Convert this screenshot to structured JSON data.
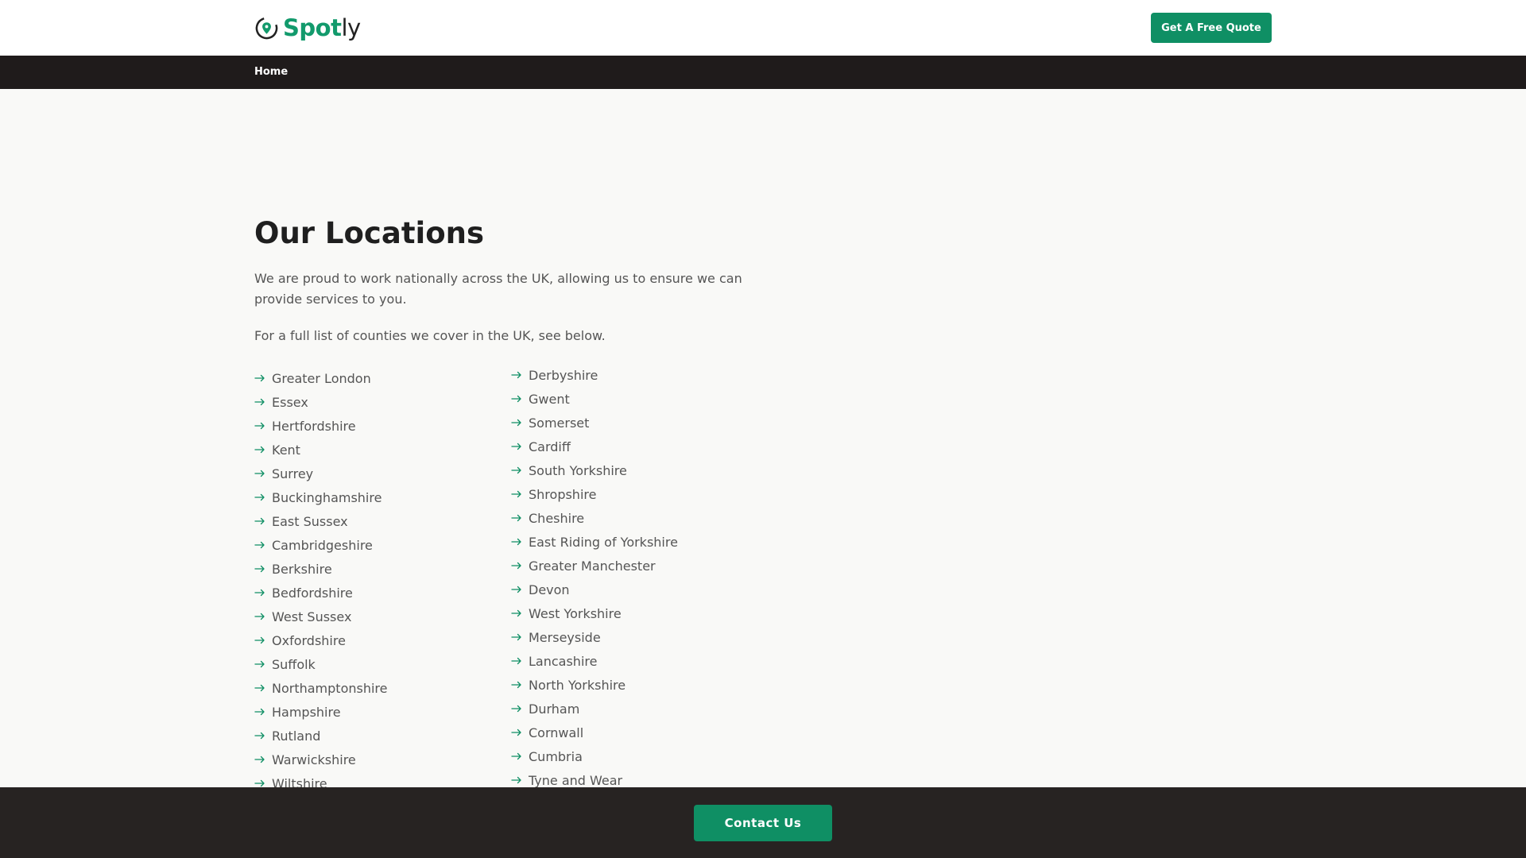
{
  "header": {
    "logo": {
      "part1": "Spot",
      "part2": "ly"
    },
    "quote_button": "Get A Free Quote"
  },
  "nav": {
    "home": "Home"
  },
  "main": {
    "title": "Our Locations",
    "intro": "We are proud to work nationally across the UK, allowing us to ensure we can provide services to you.",
    "note": "For a full list of counties we cover in the UK, see below.",
    "locations_col1": [
      "Greater London",
      "Essex",
      "Hertfordshire",
      "Kent",
      "Surrey",
      "Buckinghamshire",
      "East Sussex",
      "Cambridgeshire",
      "Berkshire",
      "Bedfordshire",
      "West Sussex",
      "Oxfordshire",
      "Suffolk",
      "Northamptonshire",
      "Hampshire",
      "Rutland",
      "Warwickshire",
      "Wiltshire"
    ],
    "locations_col2": [
      "Derbyshire",
      "Gwent",
      "Somerset",
      "Cardiff",
      "South Yorkshire",
      "Shropshire",
      "Cheshire",
      "East Riding of Yorkshire",
      "Greater Manchester",
      "Devon",
      "West Yorkshire",
      "Merseyside",
      "Lancashire",
      "North Yorkshire",
      "Durham",
      "Cornwall",
      "Cumbria",
      "Tyne and Wear"
    ]
  },
  "footer": {
    "contact_button": "Contact Us"
  },
  "icons": {
    "logo": "location-pin-icon",
    "list_bullet": "arrow-right-icon"
  },
  "colors": {
    "brand_green": "#0f8f64",
    "nav_dark": "#1f1b1b",
    "footer_dark": "#272322",
    "page_bg": "#f9f9f7"
  }
}
